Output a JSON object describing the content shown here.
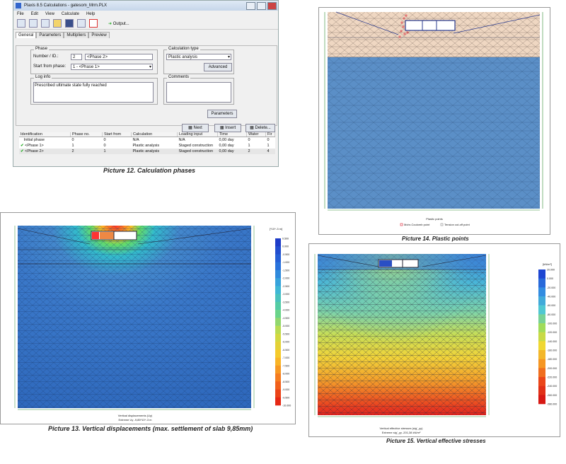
{
  "window": {
    "title": "Plaxis 8.5 Calculations - gatesom_Mrm.PLX",
    "menu": [
      "File",
      "Edit",
      "View",
      "Calculate",
      "Help"
    ],
    "output_button": "Output...",
    "tabs": [
      "General",
      "Parameters",
      "Multipliers",
      "Preview"
    ],
    "phase_group": "Phase",
    "number_label": "Number / ID.:",
    "number_value": "2",
    "phase_name": "<Phase 2>",
    "start_from_label": "Start from phase:",
    "start_from_value": "1 - <Phase 1>",
    "calc_type_group": "Calculation type",
    "calc_type_value": "Plastic analysis",
    "advanced_button": "Advanced",
    "log_group": "Log info",
    "log_text": "Prescribed ultimate state fully reached",
    "comments_group": "Comments",
    "parameters_button": "Parameters",
    "next_button": "Next",
    "insert_button": "Insert",
    "delete_button": "Delete...",
    "table_headers": [
      "Identification",
      "Phase no.",
      "Start from",
      "Calculation",
      "Loading input",
      "Time",
      "Water",
      "Fir"
    ],
    "table_rows": [
      [
        "Initial phase",
        "0",
        "0",
        "N/A",
        "N/A",
        "0,00 day",
        "0",
        "0"
      ],
      [
        "<Phase 1>",
        "1",
        "0",
        "Plastic analysis",
        "Staged construction",
        "0,00 day",
        "1",
        "1"
      ],
      [
        "<Phase 2>",
        "2",
        "1",
        "Plastic analysis",
        "Staged construction",
        "0,00 day",
        "2",
        "4"
      ]
    ]
  },
  "captions": {
    "p12": "Picture 12. Calculation phases",
    "p13": "Picture 13. Vertical displacements (max. settlement of slab 9,85mm)",
    "p14": "Picture 14. Plastic points",
    "p15": "Picture 15. Vertical effective stresses"
  },
  "plastic": {
    "title": "Plastic points",
    "legend1": "Mohr-Coulomb point",
    "legend2": "Tension cut-off point"
  },
  "displacements": {
    "unit": "[*10^-3 m]",
    "title": "Vertical displacements (Uy)",
    "extreme": "Extreme Uy -9,85*10^-3 m",
    "scale": [
      "0.500",
      "0.000",
      "-0.500",
      "-1.000",
      "-1.500",
      "-2.000",
      "-2.500",
      "-3.000",
      "-3.500",
      "-4.000",
      "-4.500",
      "-5.000",
      "-5.500",
      "-6.000",
      "-6.500",
      "-7.000",
      "-7.500",
      "-8.000",
      "-8.500",
      "-9.000",
      "-9.500",
      "-10.000"
    ]
  },
  "stresses": {
    "unit": "[kN/m²]",
    "title": "Vertical effective stresses (sig'_yy)",
    "extreme": "Extreme sig'_yy -201,38 kN/m²",
    "scale": [
      "20.000",
      "0.000",
      "-20.000",
      "-40.000",
      "-60.000",
      "-80.000",
      "-100.000",
      "-120.000",
      "-140.000",
      "-160.000",
      "-180.000",
      "-200.000",
      "-220.000",
      "-240.000",
      "-260.000",
      "-280.000"
    ]
  },
  "colors": {
    "plaxis_blue": "#5b8fc7",
    "soil_beige": "#efd7c2",
    "mesh_line": "#3a5f8c"
  }
}
